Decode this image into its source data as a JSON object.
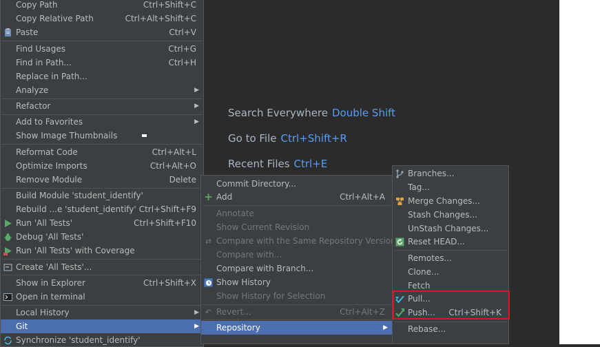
{
  "hints": [
    {
      "label": "Search Everywhere",
      "key": "Double Shift"
    },
    {
      "label": "Go to File",
      "key": "Ctrl+Shift+R"
    },
    {
      "label": "Recent Files",
      "key": "Ctrl+E"
    }
  ],
  "main_menu": {
    "copy_path": {
      "label": "Copy Path",
      "shortcut": "Ctrl+Shift+C"
    },
    "copy_relative_path": {
      "label": "Copy Relative Path",
      "shortcut": "Ctrl+Alt+Shift+C"
    },
    "paste": {
      "label": "Paste",
      "shortcut": "Ctrl+V"
    },
    "find_usages": {
      "label": "Find Usages",
      "shortcut": "Ctrl+G"
    },
    "find_in_path": {
      "label": "Find in Path...",
      "shortcut": "Ctrl+H"
    },
    "replace_in_path": {
      "label": "Replace in Path..."
    },
    "analyze": {
      "label": "Analyze"
    },
    "refactor": {
      "label": "Refactor"
    },
    "add_to_favorites": {
      "label": "Add to Favorites"
    },
    "show_image_thumbnails": {
      "label": "Show Image Thumbnails"
    },
    "reformat_code": {
      "label": "Reformat Code",
      "shortcut": "Ctrl+Alt+L"
    },
    "optimize_imports": {
      "label": "Optimize Imports",
      "shortcut": "Ctrl+Alt+O"
    },
    "remove_module": {
      "label": "Remove Module",
      "shortcut": "Delete"
    },
    "build_module": {
      "label": "Build Module 'student_identify'"
    },
    "rebuild": {
      "label": "Rebuild ...e 'student_identify'",
      "shortcut": "Ctrl+Shift+F9"
    },
    "run_all_tests": {
      "label": "Run 'All Tests'",
      "shortcut": "Ctrl+Shift+F10"
    },
    "debug_all_tests": {
      "label": "Debug 'All Tests'"
    },
    "run_with_coverage": {
      "label": "Run 'All Tests' with Coverage"
    },
    "create_all_tests": {
      "label": "Create 'All Tests'..."
    },
    "show_in_explorer": {
      "label": "Show in Explorer",
      "shortcut": "Ctrl+Shift+X"
    },
    "open_in_terminal": {
      "label": "Open in terminal"
    },
    "local_history": {
      "label": "Local History"
    },
    "git": {
      "label": "Git"
    },
    "synchronize": {
      "label": "Synchronize 'student_identify'"
    }
  },
  "git_menu": {
    "commit_directory": {
      "label": "Commit Directory..."
    },
    "add": {
      "label": "Add",
      "shortcut": "Ctrl+Alt+A"
    },
    "annotate": {
      "label": "Annotate"
    },
    "show_current_revision": {
      "label": "Show Current Revision"
    },
    "compare_same_repo_version": {
      "label": "Compare with the Same Repository Version"
    },
    "compare_with": {
      "label": "Compare with..."
    },
    "compare_with_branch": {
      "label": "Compare with Branch..."
    },
    "show_history": {
      "label": "Show History"
    },
    "show_history_selection": {
      "label": "Show History for Selection"
    },
    "revert": {
      "label": "Revert...",
      "shortcut": "Ctrl+Alt+Z"
    },
    "repository": {
      "label": "Repository"
    }
  },
  "repo_menu": {
    "branches": {
      "label": "Branches..."
    },
    "tag": {
      "label": "Tag..."
    },
    "merge_changes": {
      "label": "Merge Changes..."
    },
    "stash_changes": {
      "label": "Stash Changes..."
    },
    "unstash_changes": {
      "label": "UnStash Changes..."
    },
    "reset_head": {
      "label": "Reset HEAD..."
    },
    "remotes": {
      "label": "Remotes..."
    },
    "clone": {
      "label": "Clone..."
    },
    "fetch": {
      "label": "Fetch"
    },
    "pull": {
      "label": "Pull..."
    },
    "push": {
      "label": "Push...",
      "shortcut": "Ctrl+Shift+K"
    },
    "rebase": {
      "label": "Rebase..."
    }
  },
  "colors": {
    "menu_bg": "#3c3f41",
    "selection": "#4b6eaf",
    "shortcut_hint": "#589df6",
    "highlight_box": "#e0141e"
  }
}
